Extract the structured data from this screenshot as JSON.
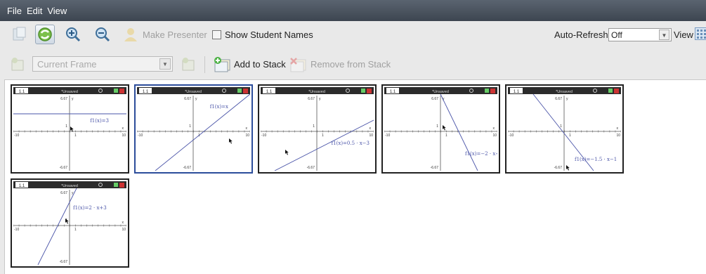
{
  "menu": [
    "File",
    "Edit",
    "View"
  ],
  "toolbar": {
    "make_presenter": "Make Presenter",
    "show_student_names": "Show Student Names",
    "auto_refresh_label": "Auto-Refresh:",
    "auto_refresh_value": "Off",
    "view_label": "View"
  },
  "toolbar2": {
    "frame_select": "Current Frame",
    "add_to_stack": "Add to Stack",
    "remove_from_stack": "Remove from Stack"
  },
  "thumb_common": {
    "tab": "1.1",
    "title": "*Unsaved",
    "y_max": "6.67",
    "y_min": "-6.67",
    "x_min": "-10",
    "x_max": "10",
    "x_tick": "1",
    "y_tick": "1",
    "x_axis_label": "x",
    "y_axis_label": "y"
  },
  "thumbnails": [
    {
      "label": "f1(x)=3"
    },
    {
      "label": "f1(x)=x"
    },
    {
      "label": "f1(x)=0.5 · x−3"
    },
    {
      "label": "f1(x)=−2 · x+5"
    },
    {
      "label": "f1(x)=−1.5 · x−1"
    },
    {
      "label": "f1(x)=2 · x+3"
    }
  ],
  "colors": {
    "graph_line": "#4a54a8",
    "selection": "#2c4d9b",
    "menubar": "#4a525c"
  }
}
